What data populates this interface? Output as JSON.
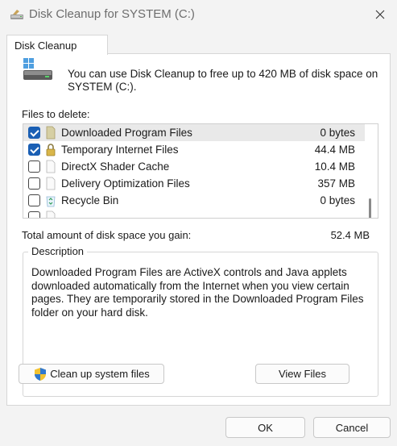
{
  "window": {
    "title": "Disk Cleanup for SYSTEM (C:)",
    "icon": "disk-cleanup-icon",
    "close_icon": "close-icon"
  },
  "tab": {
    "label": "Disk Cleanup"
  },
  "intro": {
    "text": "You can use Disk Cleanup to free up to 420 MB of disk space on SYSTEM (C:).",
    "icon": "drive-icon"
  },
  "files": {
    "label": "Files to delete:",
    "items": [
      {
        "name": "Downloaded Program Files",
        "size": "0 bytes",
        "checked": true,
        "selected": true,
        "icon": "folder-icon"
      },
      {
        "name": "Temporary Internet Files",
        "size": "44.4 MB",
        "checked": true,
        "selected": false,
        "icon": "lock-icon"
      },
      {
        "name": "DirectX Shader Cache",
        "size": "10.4 MB",
        "checked": false,
        "selected": false,
        "icon": "file-icon"
      },
      {
        "name": "Delivery Optimization Files",
        "size": "357 MB",
        "checked": false,
        "selected": false,
        "icon": "file-icon"
      },
      {
        "name": "Recycle Bin",
        "size": "0 bytes",
        "checked": false,
        "selected": false,
        "icon": "recycle-bin-icon"
      }
    ]
  },
  "total": {
    "label": "Total amount of disk space you gain:",
    "value": "52.4 MB"
  },
  "description": {
    "legend": "Description",
    "text": "Downloaded Program Files are ActiveX controls and Java applets downloaded automatically from the Internet when you view certain pages. They are temporarily stored in the Downloaded Program Files folder on your hard disk."
  },
  "buttons": {
    "cleanup_system": "Clean up system files",
    "view_files": "View Files",
    "ok": "OK",
    "cancel": "Cancel"
  },
  "colors": {
    "accent": "#1a5fb4",
    "window_bg": "#f3f3f3",
    "panel_bg": "#ffffff"
  }
}
